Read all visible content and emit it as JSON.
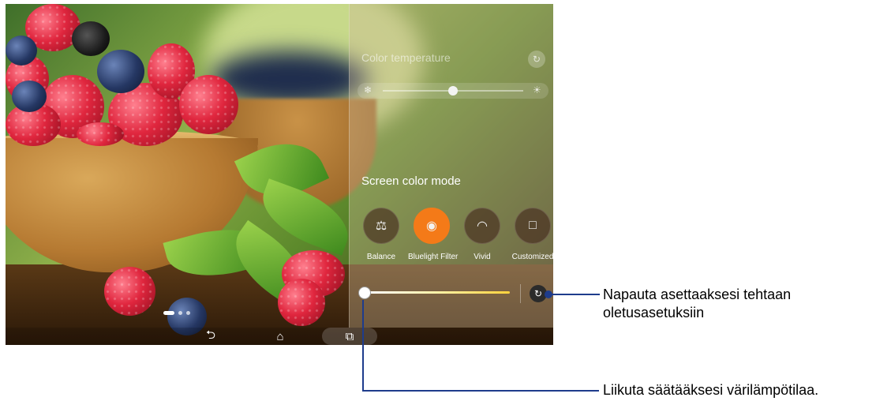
{
  "panel": {
    "color_temperature_title": "Color temperature",
    "screen_color_mode_title": "Screen color mode",
    "color_temperature_level": 0.5,
    "bluelight_level": 0.0,
    "modes": [
      {
        "label": "Balance",
        "icon": "balance-icon",
        "active": false
      },
      {
        "label": "Bluelight Filter",
        "icon": "eye-shield-icon",
        "active": true
      },
      {
        "label": "Vivid",
        "icon": "rainbow-icon",
        "active": false
      },
      {
        "label": "Customized",
        "icon": "customize-icon",
        "active": false
      }
    ],
    "accent_color": "#f47a18"
  },
  "navbar": {
    "back_icon": "back-icon",
    "home_icon": "home-icon",
    "recent_icon": "recent-apps-icon"
  },
  "callouts": {
    "reset": "Napauta asettaaksesi tehtaan oletusasetuksiin",
    "slider": "Liikuta säätääksesi värilämpötilaa."
  }
}
